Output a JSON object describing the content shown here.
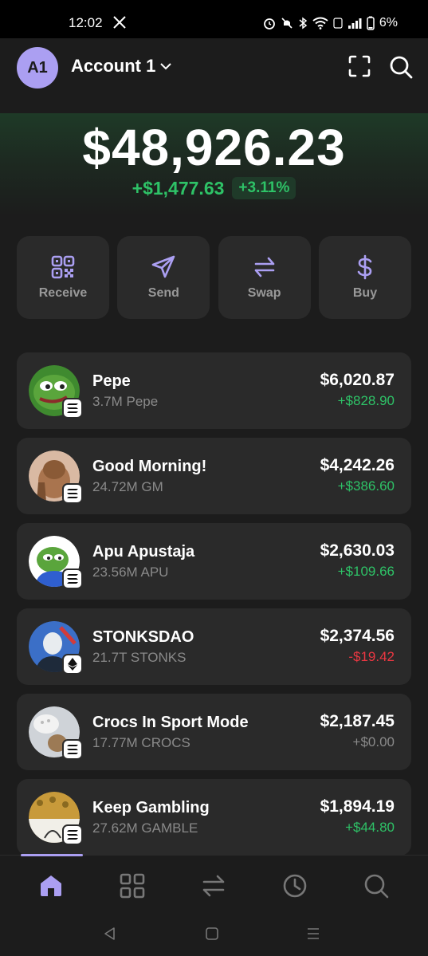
{
  "status_bar": {
    "time": "12:02",
    "battery": "6%"
  },
  "header": {
    "avatar_initials": "A1",
    "account_name": "Account 1"
  },
  "portfolio": {
    "balance": "$48,926.23",
    "change_amount": "+$1,477.63",
    "change_percent": "+3.11%"
  },
  "actions": [
    {
      "label": "Receive",
      "icon": "qr-code-icon"
    },
    {
      "label": "Send",
      "icon": "send-icon"
    },
    {
      "label": "Swap",
      "icon": "swap-icon"
    },
    {
      "label": "Buy",
      "icon": "dollar-icon"
    }
  ],
  "tokens": [
    {
      "name": "Pepe",
      "amount": "3.7M Pepe",
      "value": "$6,020.87",
      "change": "+$828.90",
      "change_dir": "pos",
      "chain": "solana"
    },
    {
      "name": "Good Morning!",
      "amount": "24.72M GM",
      "value": "$4,242.26",
      "change": "+$386.60",
      "change_dir": "pos",
      "chain": "solana"
    },
    {
      "name": "Apu Apustaja",
      "amount": "23.56M APU",
      "value": "$2,630.03",
      "change": "+$109.66",
      "change_dir": "pos",
      "chain": "solana"
    },
    {
      "name": "STONKSDAO",
      "amount": "21.7T STONKS",
      "value": "$2,374.56",
      "change": "-$19.42",
      "change_dir": "neg",
      "chain": "ethereum"
    },
    {
      "name": "Crocs In Sport Mode",
      "amount": "17.77M CROCS",
      "value": "$2,187.45",
      "change": "+$0.00",
      "change_dir": "neutral",
      "chain": "solana"
    },
    {
      "name": "Keep Gambling",
      "amount": "27.62M GAMBLE",
      "value": "$1,894.19",
      "change": "+$44.80",
      "change_dir": "pos",
      "chain": "solana"
    }
  ],
  "bottom_nav": [
    "home-icon",
    "grid-icon",
    "swap-icon",
    "history-icon",
    "search-icon"
  ],
  "colors": {
    "accent": "#ab9ff2",
    "positive": "#2ec267",
    "negative": "#eb3742",
    "card": "#2a2a2a",
    "background": "#1c1c1c"
  }
}
